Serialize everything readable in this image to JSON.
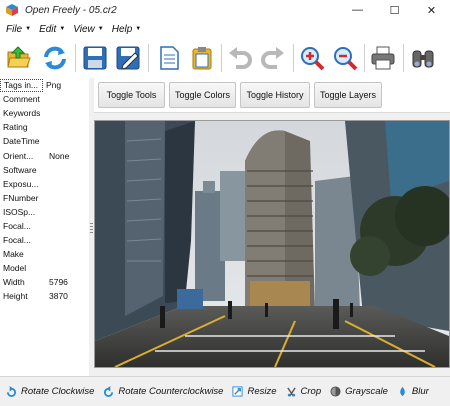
{
  "window": {
    "title": "Open Freely - 05.cr2",
    "minimize_glyph": "—",
    "maximize_glyph": "☐",
    "close_glyph": "✕"
  },
  "menu": [
    {
      "label": "File",
      "arrow": "▼"
    },
    {
      "label": "Edit",
      "arrow": "▼"
    },
    {
      "label": "View",
      "arrow": "▼"
    },
    {
      "label": "Help",
      "arrow": "▼"
    }
  ],
  "toolbar": {
    "icons": [
      "open-folder-icon",
      "refresh-icon",
      "save-icon",
      "save-as-icon",
      "document-icon",
      "clipboard-icon",
      "undo-icon",
      "redo-icon",
      "zoom-in-icon",
      "zoom-out-icon",
      "print-icon",
      "binoculars-icon"
    ]
  },
  "properties": {
    "header": {
      "key": "Tags in...",
      "value": "Png"
    },
    "rows": [
      {
        "key": "Comment",
        "value": ""
      },
      {
        "key": "Keywords",
        "value": ""
      },
      {
        "key": "Rating",
        "value": ""
      },
      {
        "key": "DateTime",
        "value": ""
      },
      {
        "key": "Orient...",
        "value": "None"
      },
      {
        "key": "Software",
        "value": ""
      },
      {
        "key": "Exposu...",
        "value": ""
      },
      {
        "key": "FNumber",
        "value": ""
      },
      {
        "key": "ISOSp...",
        "value": ""
      },
      {
        "key": "Focal...",
        "value": ""
      },
      {
        "key": "Focal...",
        "value": ""
      },
      {
        "key": "Make",
        "value": ""
      },
      {
        "key": "Model",
        "value": ""
      },
      {
        "key": "Width",
        "value": "5796"
      },
      {
        "key": "Height",
        "value": "3870"
      }
    ]
  },
  "toggles": [
    {
      "label": "Toggle Tools"
    },
    {
      "label": "Toggle Colors"
    },
    {
      "label": "Toggle History"
    },
    {
      "label": "Toggle Layers"
    }
  ],
  "actions": [
    {
      "label": "Rotate Clockwise",
      "icon": "rotate-clockwise-icon"
    },
    {
      "label": "Rotate Counterclockwise",
      "icon": "rotate-counterclockwise-icon"
    },
    {
      "label": "Resize",
      "icon": "resize-icon"
    },
    {
      "label": "Crop",
      "icon": "crop-icon"
    },
    {
      "label": "Grayscale",
      "icon": "grayscale-icon"
    },
    {
      "label": "Blur",
      "icon": "blur-icon"
    }
  ],
  "colors": {
    "accent": "#2a8ad8",
    "danger": "#d42a2a"
  }
}
